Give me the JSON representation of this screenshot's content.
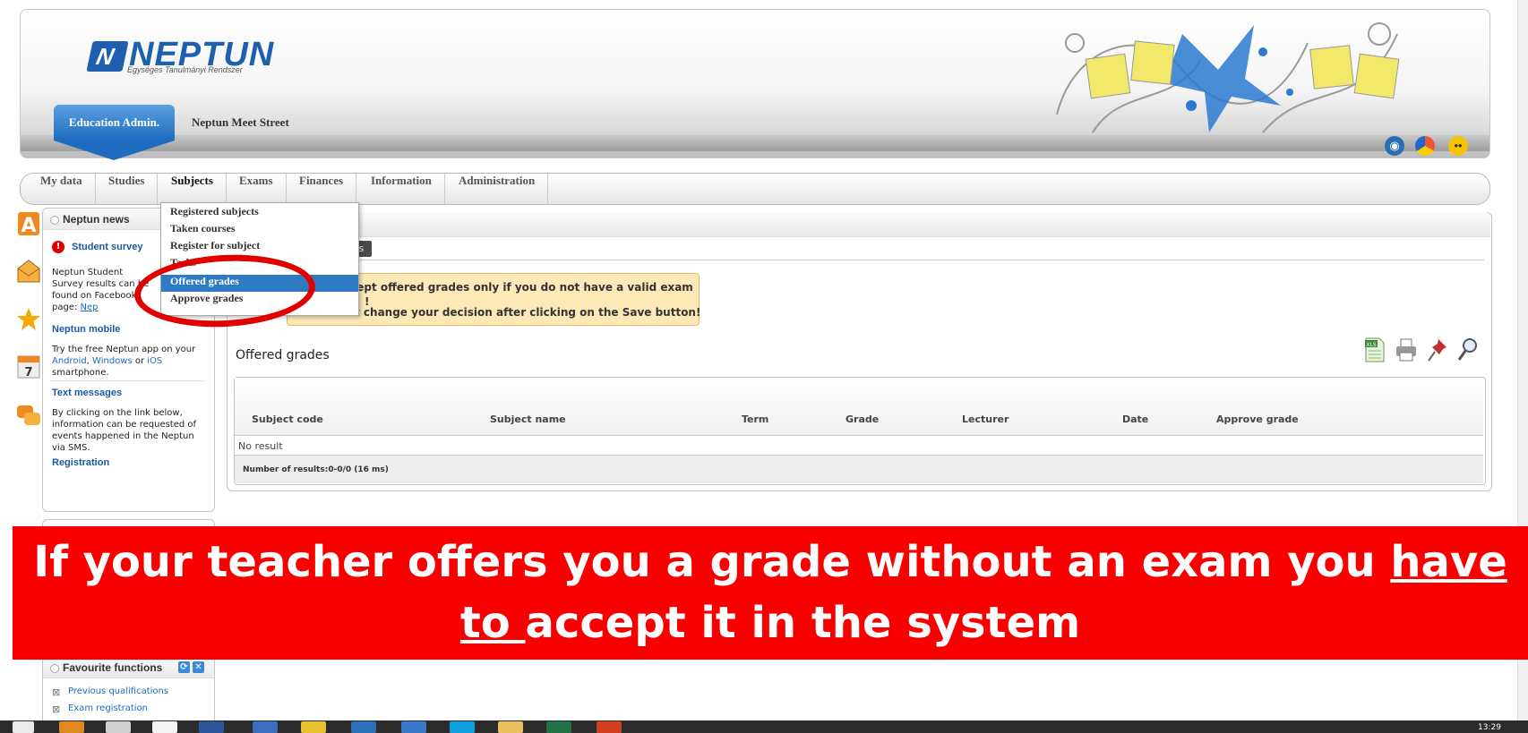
{
  "header": {
    "logo_mark": "N",
    "logo_text": "NEPTUN",
    "logo_subtitle": "Egységes Tanulmányi Rendszer",
    "edu_tab": "Education Admin.",
    "meet_street": "Neptun Meet Street"
  },
  "nav": {
    "items": [
      "My data",
      "Studies",
      "Subjects",
      "Exams",
      "Finances",
      "Information",
      "Administration"
    ],
    "active": "Subjects"
  },
  "dropdown": {
    "items": [
      "Registered subjects",
      "Taken courses",
      "Register for subject",
      "Tasks",
      "Offered grades",
      "Approve grades"
    ],
    "selected": "Offered grades"
  },
  "news": {
    "title": "Neptun news",
    "survey_title": "Student survey",
    "survey_text": "Neptun Student Survey results can be found on Facebook page:",
    "survey_link": "Nep",
    "mobile_title": "Neptun mobile",
    "mobile_text_1": "Try the free Neptun app on your",
    "mobile_android": "Android",
    "mobile_windows": "Windows",
    "mobile_or": "or",
    "mobile_ios": "iOS",
    "mobile_text_2": "smartphone.",
    "sms_title": "Text messages",
    "sms_text": "By clicking on the link below, information can be requested of events happened in the Neptun via SMS.",
    "sms_link": "Registration"
  },
  "main": {
    "subtab": "es",
    "warning_line1": "ccept offered grades only if you do not have a valid exam",
    "warning_line2": "!",
    "warning_line3": "t change your decision after clicking on the Save button!",
    "section_title": "Offered grades",
    "columns": [
      "Subject code",
      "Subject name",
      "Term",
      "Grade",
      "Lecturer",
      "Date",
      "Approve grade"
    ],
    "no_result": "No result",
    "count": "Number of results:0-0/0 (16 ms)"
  },
  "banner": {
    "text_before": "If your teacher offers you a grade without an exam you ",
    "underlined": "have to ",
    "text_after": "accept it in the system"
  },
  "favourites": {
    "title": "Favourite functions",
    "items": [
      "Previous qualifications",
      "Exam registration"
    ]
  },
  "taskbar": {
    "clock": "13:29"
  },
  "colors": {
    "accent": "#2e7bc4",
    "banner": "#f80000",
    "warning_bg": "#fde8b8",
    "link": "#1a6ec0"
  }
}
